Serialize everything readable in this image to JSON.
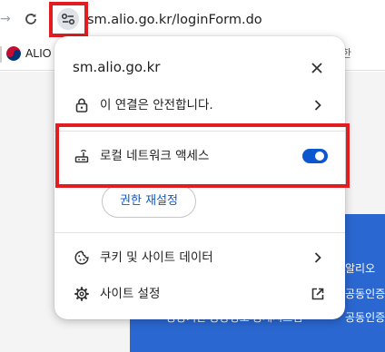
{
  "browser": {
    "url": "sm.alio.go.kr/loginForm.do"
  },
  "bookmarks": {
    "items": [
      {
        "label": "ALIO"
      }
    ],
    "right_partial": "한"
  },
  "background_page": {
    "lines_right": [
      "알리오",
      "공동인증",
      "공동인증"
    ],
    "bottom_partial": "공공기관 공공정보 공개시스템"
  },
  "popup": {
    "site": "sm.alio.go.kr",
    "connection_label": "이 연결은 안전합니다.",
    "local_network_label": "로컬 네트워크 액세스",
    "local_network_enabled": true,
    "reset_permissions_label": "권한 재설정",
    "cookies_label": "쿠키 및 사이트 데이터",
    "site_settings_label": "사이트 설정"
  },
  "colors": {
    "highlight": "#e11d22",
    "toggle_on": "#0b57d0",
    "page_blue": "#2a67d0"
  }
}
